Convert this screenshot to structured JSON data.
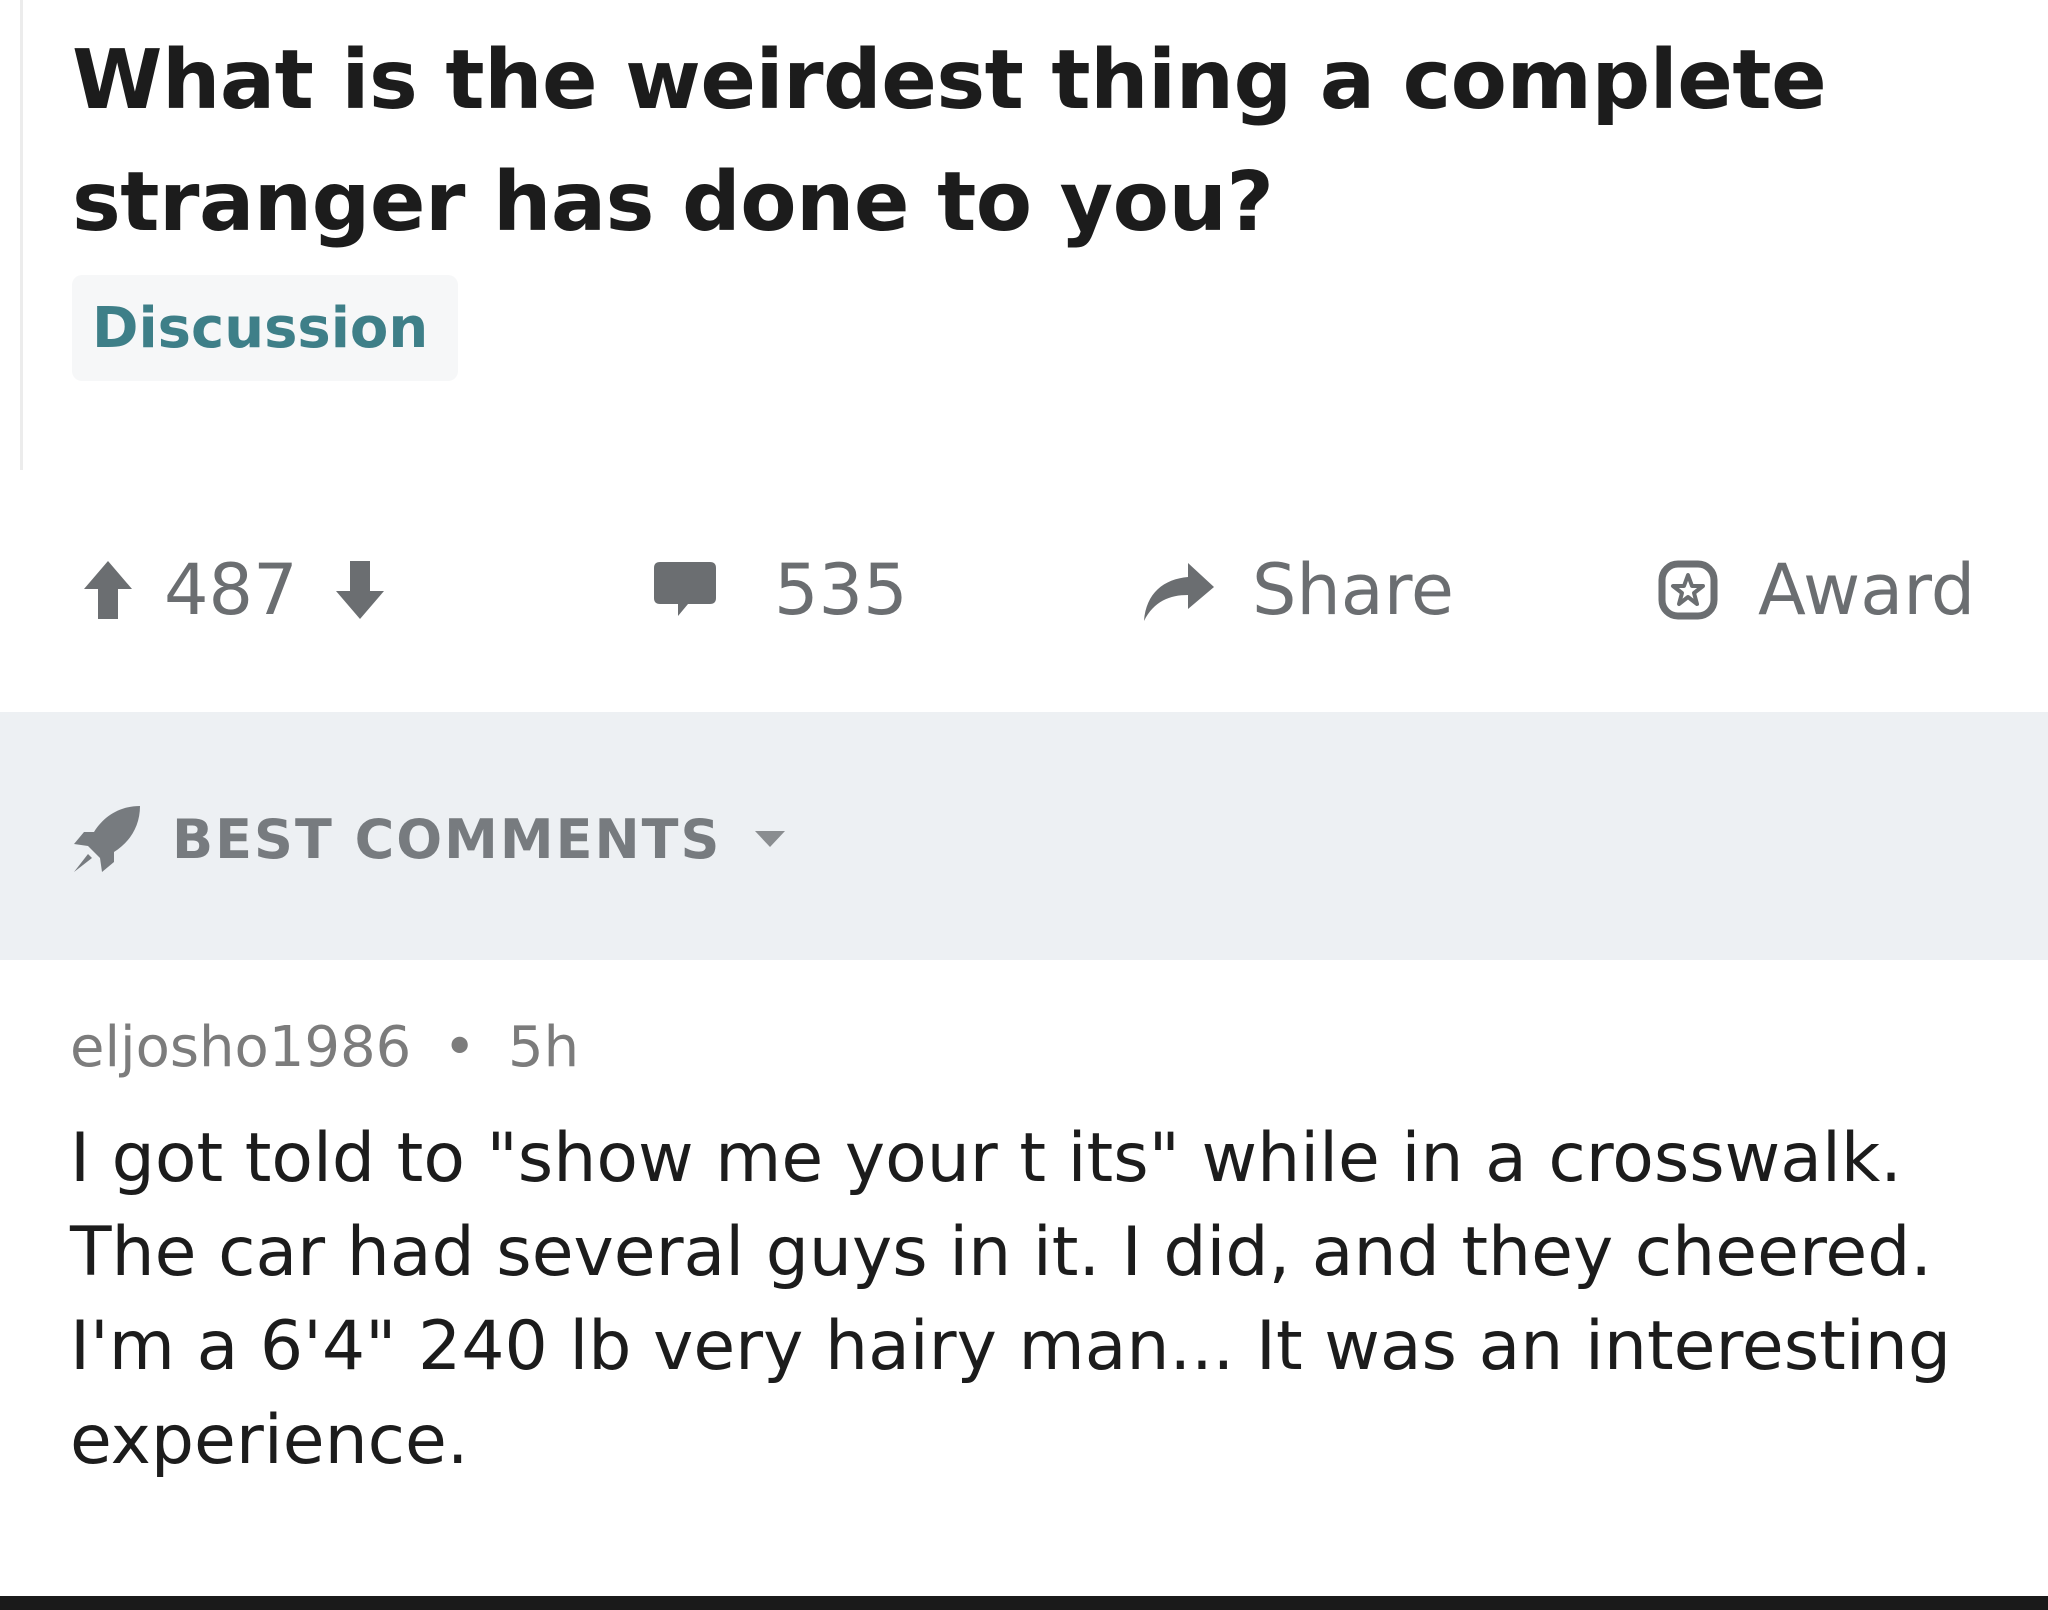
{
  "post": {
    "title": "What is the weirdest thing a complete stranger has done to you?",
    "flair": "Discussion"
  },
  "actions": {
    "score": "487",
    "comment_count": "535",
    "share_label": "Share",
    "award_label": "Award"
  },
  "sort": {
    "label": "BEST COMMENTS"
  },
  "comment": {
    "author": "eljosho1986",
    "separator": "•",
    "age": "5h",
    "body": "I got told to \"show me your t its\" while in a crosswalk. The car had several guys in it. I did, and they cheered. I'm a 6'4\" 240 lb very hairy man... It was an interesting experience."
  },
  "icons": {
    "upvote": "arrow-up-icon",
    "downvote": "arrow-down-icon",
    "comments": "comment-bubble-icon",
    "share": "share-arrow-icon",
    "award": "award-badge-icon",
    "sort": "rocket-icon",
    "sort_dropdown": "caret-down-icon"
  },
  "colors": {
    "flair_text": "#3e7f88",
    "icon_gray": "#6b6e71",
    "sort_bar_bg": "#edf0f3",
    "meta_text": "#7c7c7c"
  }
}
